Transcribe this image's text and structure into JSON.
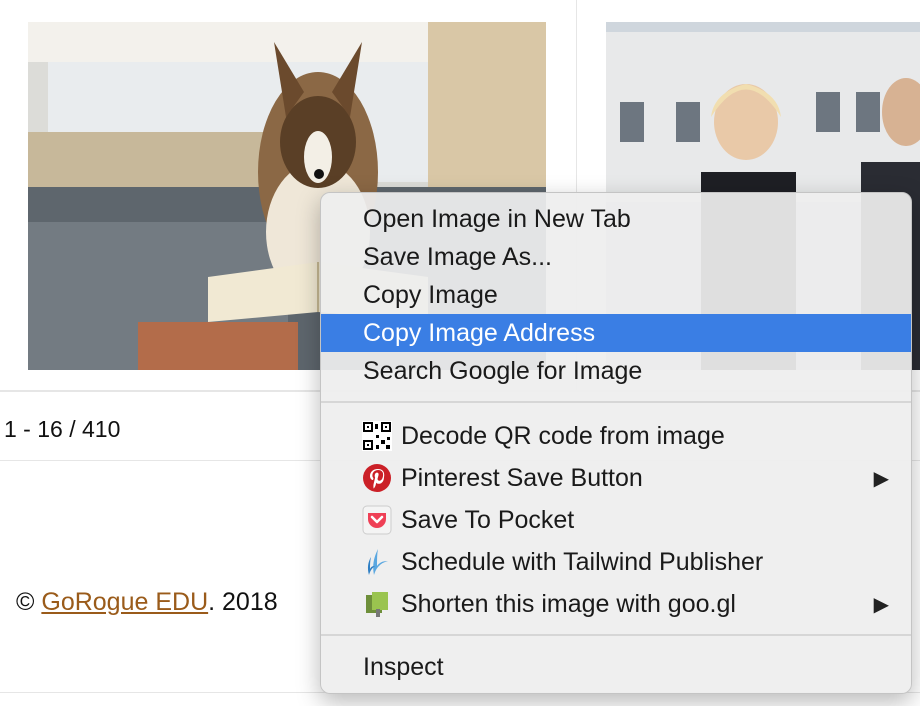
{
  "pager": {
    "text": "1 - 16 / 410"
  },
  "footer": {
    "copyright": "©",
    "link": "GoRogue EDU",
    "suffix": ". 2018"
  },
  "context_menu": {
    "items": [
      {
        "label": "Open Image in New Tab"
      },
      {
        "label": "Save Image As..."
      },
      {
        "label": "Copy Image"
      },
      {
        "label": "Copy Image Address",
        "highlighted": true
      },
      {
        "label": "Search Google for Image"
      }
    ],
    "extensions": [
      {
        "label": "Decode QR code from image",
        "icon": "qr-code-icon"
      },
      {
        "label": "Pinterest Save Button",
        "icon": "pinterest-icon",
        "submenu": true
      },
      {
        "label": "Save To Pocket",
        "icon": "pocket-icon"
      },
      {
        "label": "Schedule with Tailwind Publisher",
        "icon": "tailwind-icon"
      },
      {
        "label": "Shorten this image with goo.gl",
        "icon": "googl-shortener-icon",
        "submenu": true
      }
    ],
    "inspect": {
      "label": "Inspect"
    },
    "submenu_arrow": "▶"
  },
  "colors": {
    "highlight": "#3a7ee4",
    "link": "#9a5b1a",
    "pinterest": "#cb2027",
    "pocket": "#ef4056"
  }
}
